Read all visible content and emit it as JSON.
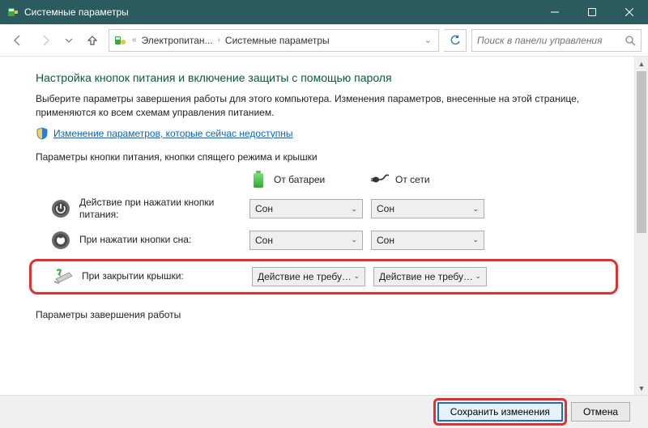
{
  "window": {
    "title": "Системные параметры"
  },
  "nav": {
    "crumb1": "Электропитан...",
    "crumb2": "Системные параметры",
    "search_placeholder": "Поиск в панели управления"
  },
  "page": {
    "heading": "Настройка кнопок питания и включение защиты с помощью пароля",
    "description": "Выберите параметры завершения работы для этого компьютера. Изменения параметров, внесенные на этой странице, применяются ко всем схемам управления питанием.",
    "unlock_link": "Изменение параметров, которые сейчас недоступны",
    "section1_title": "Параметры кнопки питания, кнопки спящего режима и крышки",
    "col_battery": "От батареи",
    "col_ac": "От сети",
    "rows": [
      {
        "label": "Действие при нажатии кнопки питания:",
        "battery": "Сон",
        "ac": "Сон"
      },
      {
        "label": "При нажатии кнопки сна:",
        "battery": "Сон",
        "ac": "Сон"
      },
      {
        "label": "При закрытии крышки:",
        "battery": "Действие не требуется",
        "ac": "Действие не требуется"
      }
    ],
    "section2_title": "Параметры завершения работы"
  },
  "footer": {
    "save": "Сохранить изменения",
    "cancel": "Отмена"
  }
}
